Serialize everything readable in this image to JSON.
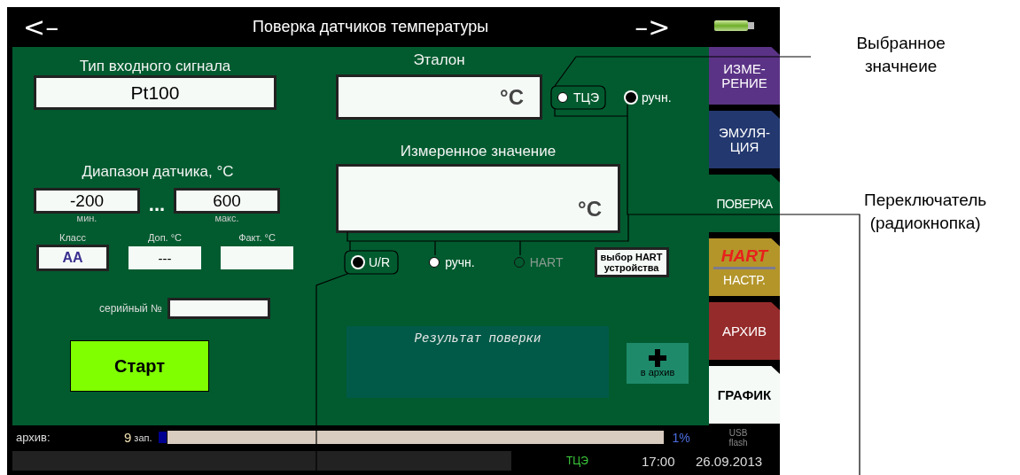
{
  "header": {
    "back": "<–",
    "title": "Поверка датчиков температуры",
    "forward": "–>"
  },
  "input_signal": {
    "label": "Тип входного сигнала",
    "value": "Pt100"
  },
  "range": {
    "label": "Диапазон датчика, °C",
    "min": {
      "value": "-200",
      "caption": "мин."
    },
    "separator": "...",
    "max": {
      "value": "600",
      "caption": "макс."
    }
  },
  "class_fields": [
    {
      "label": "Класс",
      "value": "AA"
    },
    {
      "label": "Доп. °C",
      "value": "---"
    },
    {
      "label": "Факт. °C"
    }
  ],
  "serial": {
    "label": "серийный №"
  },
  "start_button": "Старт",
  "reference": {
    "label": "Эталон",
    "unit": "°C",
    "sources": [
      {
        "label": "ТЦЭ",
        "selected": false,
        "disabled": false
      },
      {
        "label": "ручн.",
        "selected": true,
        "disabled": false
      }
    ]
  },
  "measured": {
    "label": "Измеренное значение",
    "unit": "°C",
    "sources": [
      {
        "label": "U/R",
        "selected": true,
        "disabled": false
      },
      {
        "label": "ручн.",
        "selected": false,
        "disabled": false
      },
      {
        "label": "HART",
        "selected": false,
        "disabled": true
      }
    ],
    "hart_button": "выбор HART\nустройства"
  },
  "result": {
    "label": "Результат поверки"
  },
  "archive_button": {
    "label": "в архив"
  },
  "tabs": [
    {
      "kind": "text",
      "label": "ИЗМЕ-\nРЕНИЕ",
      "color": "#5b3386",
      "selected": false
    },
    {
      "kind": "text",
      "label": "ЭМУЛЯ-\nЦИЯ",
      "color": "#23386f",
      "selected": false
    },
    {
      "kind": "text",
      "label": "ПОВЕРКА",
      "color": "#015b2f",
      "selected": true
    },
    {
      "kind": "hart",
      "label": "HART",
      "sublabel": "НАСТР.",
      "color": "#b3952a",
      "selected": false
    },
    {
      "kind": "text",
      "label": "АРХИВ",
      "color": "#962b2b",
      "selected": false
    },
    {
      "kind": "text",
      "label": "ГРАФИК",
      "color": "#f5faf6",
      "selected": false
    }
  ],
  "status_bar": {
    "archive_label": "архив:",
    "count": "9",
    "count_unit": "зап.",
    "level": 0.02,
    "percent": "1%",
    "storage": "USB\nflash",
    "source": "ТЦЭ",
    "time": "17:00",
    "date": "26.09.2013"
  },
  "annotations": [
    {
      "text": "Выбранное\nзначнеие"
    },
    {
      "text": "Переключатель\n(радиокнопка)"
    }
  ]
}
